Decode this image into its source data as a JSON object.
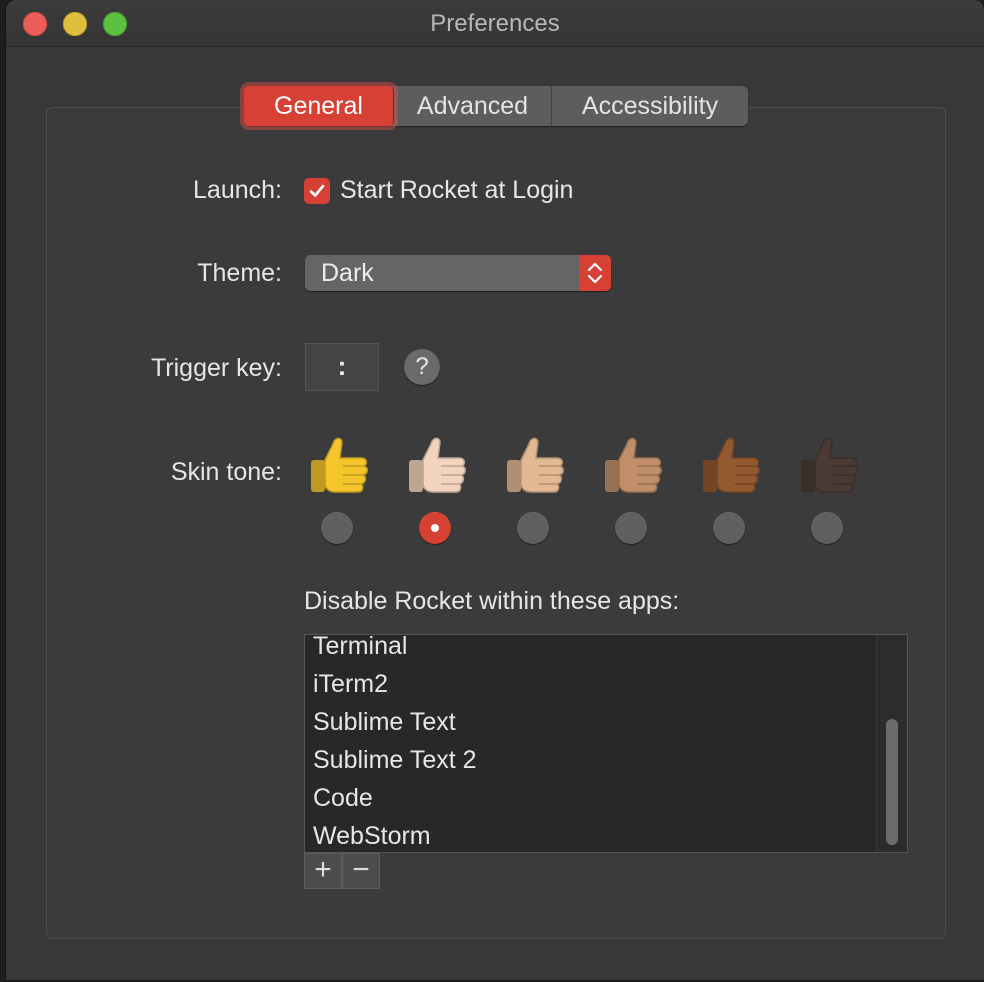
{
  "window": {
    "title": "Preferences"
  },
  "tabs": [
    {
      "label": "General",
      "active": true
    },
    {
      "label": "Advanced",
      "active": false
    },
    {
      "label": "Accessibility",
      "active": false
    }
  ],
  "launch": {
    "label": "Launch:",
    "checkbox_label": "Start Rocket at Login",
    "checked": true
  },
  "theme": {
    "label": "Theme:",
    "value": "Dark"
  },
  "trigger": {
    "label": "Trigger key:",
    "value": ":",
    "help": "?"
  },
  "skin": {
    "label": "Skin tone:",
    "selected_index": 1,
    "tones": [
      "#f5c62b",
      "#f2d3bd",
      "#e2b992",
      "#c08f69",
      "#93592f",
      "#4b3a33"
    ]
  },
  "apps": {
    "label": "Disable Rocket within these apps:",
    "items": [
      "Terminal",
      "iTerm2",
      "Sublime Text",
      "Sublime Text 2",
      "Code",
      "WebStorm"
    ],
    "add": "+",
    "remove": "−"
  },
  "colors": {
    "accent": "#d74034",
    "background": "#383838"
  }
}
